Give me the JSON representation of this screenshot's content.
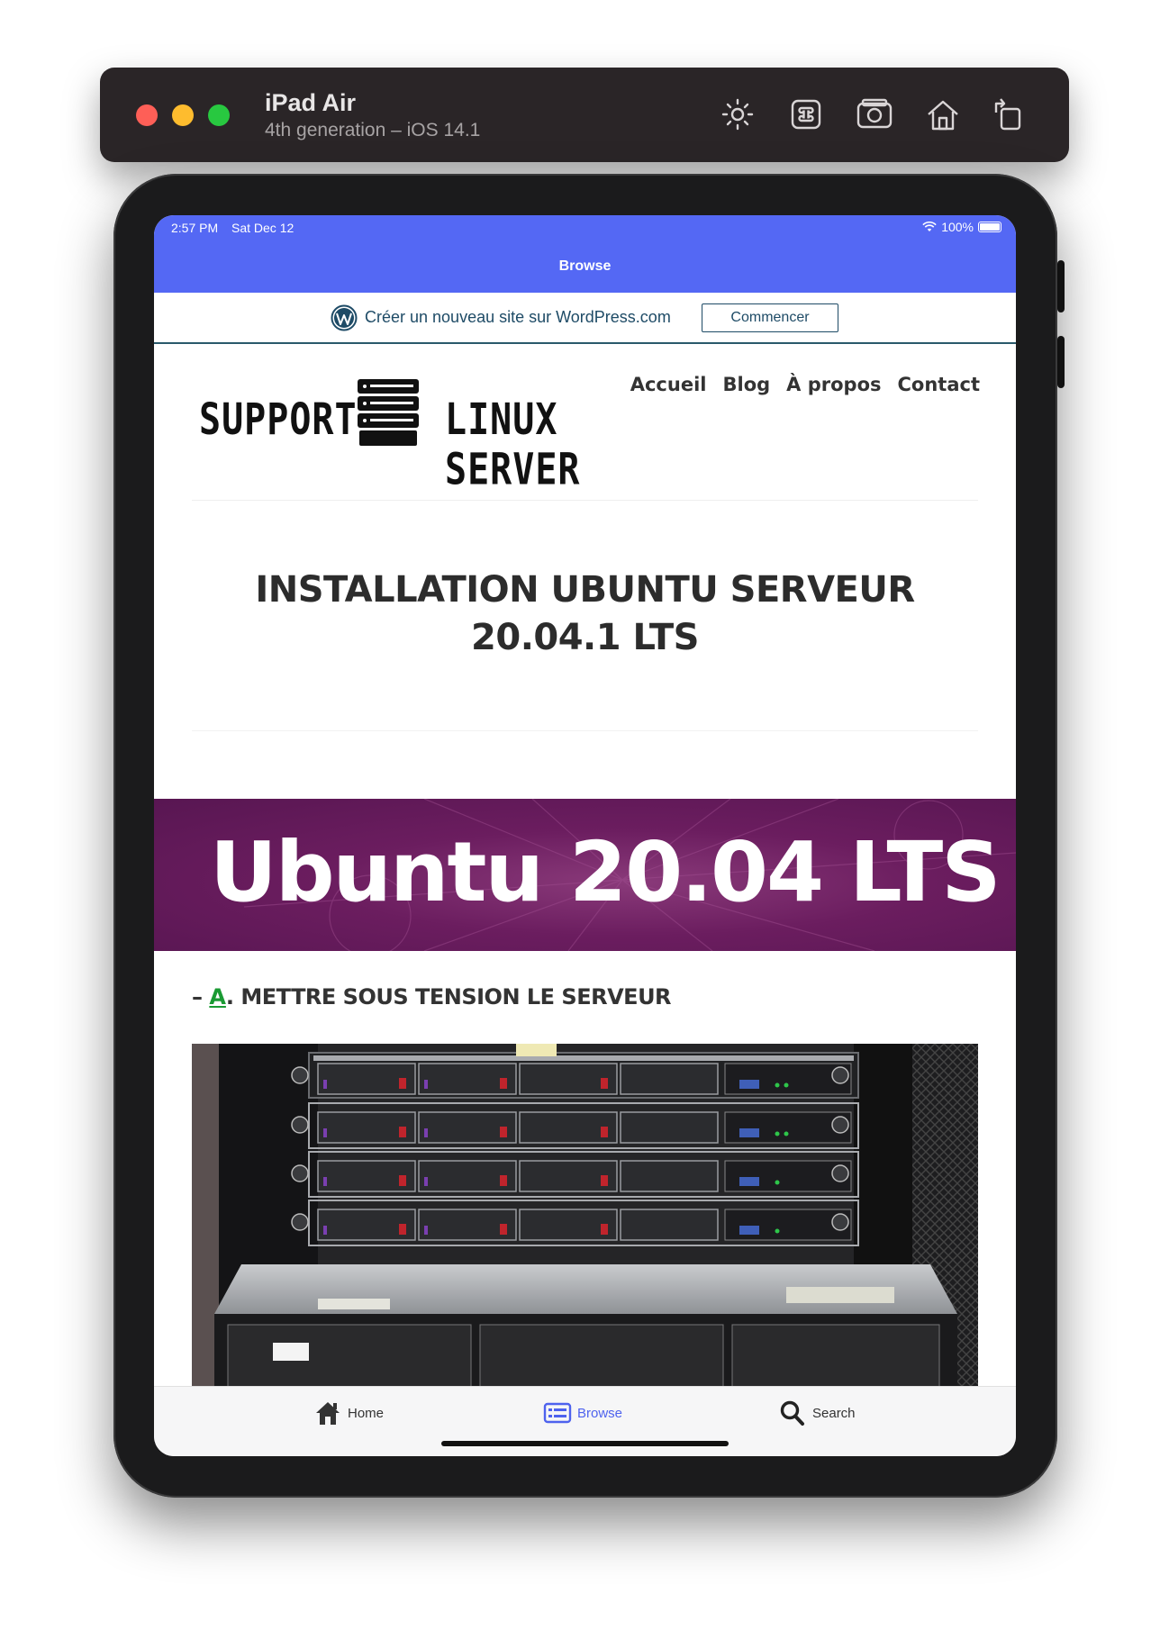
{
  "simulator": {
    "device_name": "iPad Air",
    "device_subtitle": "4th generation – iOS 14.1",
    "tools": [
      "brightness-icon",
      "command-icon",
      "screenshot-icon",
      "home-icon",
      "rotate-icon"
    ]
  },
  "status_bar": {
    "time": "2:57 PM",
    "date": "Sat Dec 12",
    "battery": "100%"
  },
  "nav": {
    "title": "Browse"
  },
  "wordpress_banner": {
    "text": "Créer un nouveau site sur WordPress.com",
    "button_label": "Commencer"
  },
  "site": {
    "logo_left": "SUPPORT",
    "logo_right": "LINUX SERVER",
    "menu": [
      "Accueil",
      "Blog",
      "À propos",
      "Contact"
    ]
  },
  "post": {
    "title_line1": "INSTALLATION UBUNTU SERVEUR",
    "title_line2": "20.04.1 LTS",
    "banner_text": "Ubuntu 20.04 LTS",
    "section_prefix": "– ",
    "section_letter": "A",
    "section_text": ". METTRE SOUS TENSION LE SERVEUR"
  },
  "tabbar": {
    "tabs": [
      {
        "label": "Home",
        "icon": "home-icon",
        "active": false
      },
      {
        "label": "Browse",
        "icon": "list-icon",
        "active": true
      },
      {
        "label": "Search",
        "icon": "search-icon",
        "active": false
      }
    ]
  },
  "colors": {
    "nav_blue": "#5468f4",
    "active_tab": "#4e62ee",
    "ubuntu_purple": "#6b1d5f",
    "section_link_green": "#1a9a33"
  }
}
